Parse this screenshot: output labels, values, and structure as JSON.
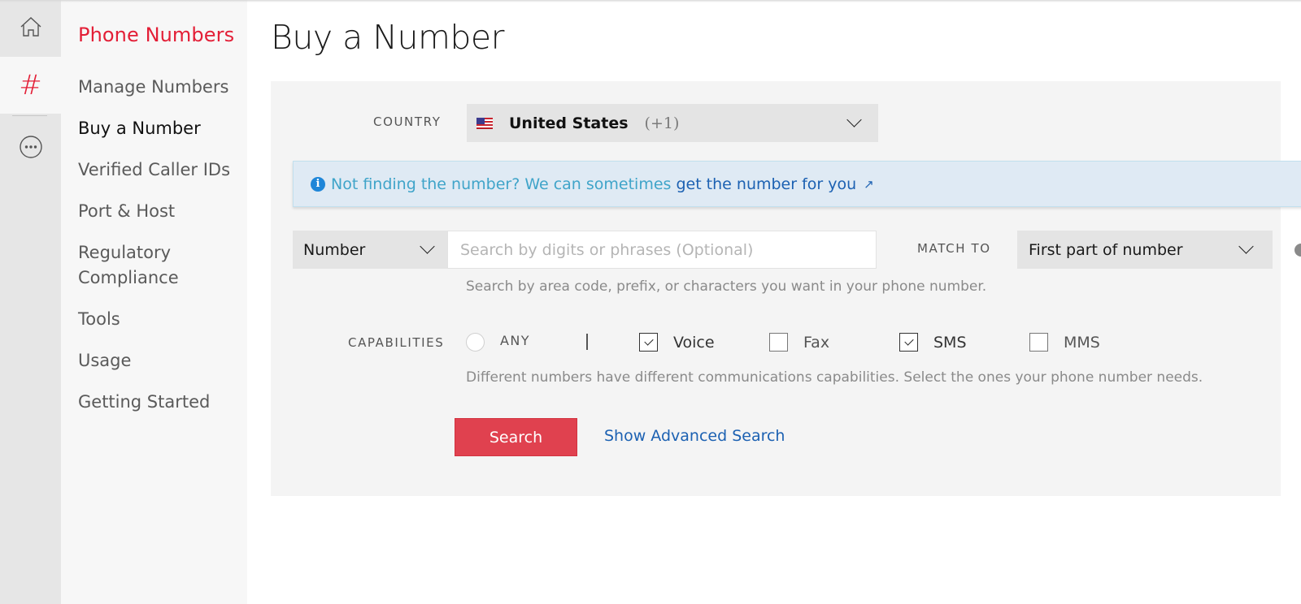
{
  "rail": {
    "items": [
      {
        "name": "home",
        "icon": "home-icon",
        "active": false
      },
      {
        "name": "phone-numbers",
        "icon": "hash-icon",
        "glyph": "#",
        "active": true
      },
      {
        "name": "more",
        "icon": "more-dots-icon",
        "active": false
      }
    ]
  },
  "nav": {
    "title": "Phone Numbers",
    "items": [
      {
        "label": "Manage Numbers",
        "active": false
      },
      {
        "label": "Buy a Number",
        "active": true
      },
      {
        "label": "Verified Caller IDs",
        "active": false
      },
      {
        "label": "Port & Host",
        "active": false
      },
      {
        "label": "Regulatory Compliance",
        "active": false
      },
      {
        "label": "Tools",
        "active": false
      },
      {
        "label": "Usage",
        "active": false
      },
      {
        "label": "Getting Started",
        "active": false
      }
    ]
  },
  "page": {
    "title": "Buy a Number"
  },
  "form": {
    "country": {
      "label": "COUNTRY",
      "flag_icon": "us-flag-icon",
      "value": "United States",
      "code": "(+1)"
    },
    "banner": {
      "text": "Not finding the number? We can sometimes",
      "link_text": "get the number for you",
      "external_glyph": "↗"
    },
    "search": {
      "type_value": "Number",
      "placeholder": "Search by digits or phrases (Optional)",
      "value": "",
      "hint": "Search by area code, prefix, or characters you want in your phone number."
    },
    "match_to": {
      "label": "MATCH TO",
      "value": "First part of number"
    },
    "capabilities": {
      "label": "CAPABILITIES",
      "any_label": "ANY",
      "any_selected": false,
      "separator": "|",
      "options": [
        {
          "label": "Voice",
          "checked": true
        },
        {
          "label": "Fax",
          "checked": false
        },
        {
          "label": "SMS",
          "checked": true
        },
        {
          "label": "MMS",
          "checked": false
        }
      ],
      "hint": "Different numbers have different communications capabilities. Select the ones your phone number needs."
    },
    "search_button": "Search",
    "advanced_link": "Show Advanced Search"
  },
  "colors": {
    "brand_red": "#e31e36",
    "button_red": "#e0414f",
    "link_blue": "#1c61b2",
    "banner_bg": "#dfeaf4",
    "info_blue": "#1e86d8"
  }
}
